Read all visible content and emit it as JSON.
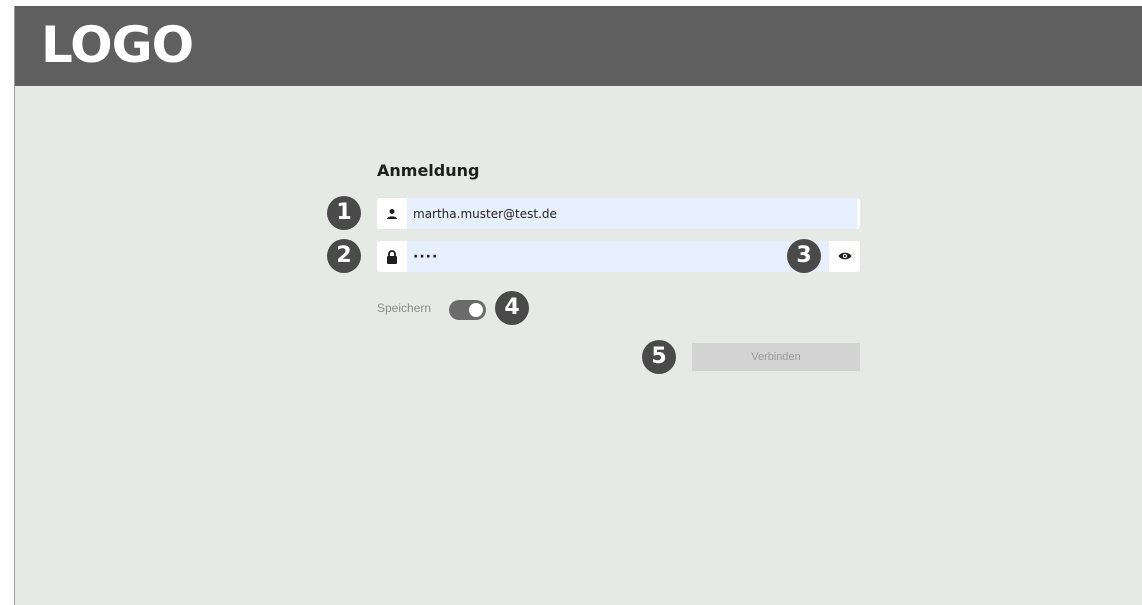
{
  "header": {
    "logo_text": "LOGO",
    "background_color": "#5f5f5f"
  },
  "login": {
    "title": "Anmeldung",
    "email": {
      "icon": "user-icon",
      "value": "martha.muster@test.de"
    },
    "password": {
      "icon": "lock-icon",
      "value": "····",
      "toggle_icon": "eye-icon"
    },
    "remember": {
      "label": "Speichern",
      "enabled": true
    },
    "submit_label": "Verbinden"
  },
  "annotations": [
    "1",
    "2",
    "3",
    "4",
    "5"
  ],
  "colors": {
    "page_background": "#e7e9e7",
    "input_background": "#e8effc",
    "badge": "#4a4a4a",
    "button_disabled": "#d3d3d3"
  }
}
